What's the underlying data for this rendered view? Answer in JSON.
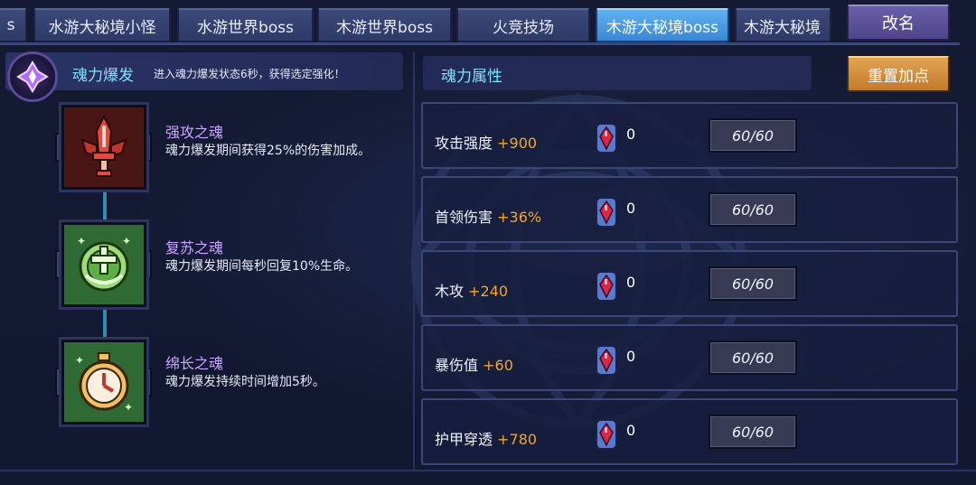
{
  "tabs": [
    {
      "label": "s",
      "active": false
    },
    {
      "label": "水游大秘境小怪",
      "active": false
    },
    {
      "label": "水游世界boss",
      "active": false
    },
    {
      "label": "木游世界boss",
      "active": false
    },
    {
      "label": "火竞技场",
      "active": false
    },
    {
      "label": "木游大秘境boss",
      "active": true
    },
    {
      "label": "木游大秘境",
      "active": false
    }
  ],
  "rename_label": "改名",
  "burst": {
    "title": "魂力爆发",
    "description": "进入魂力爆发状态6秒，获得选定强化！"
  },
  "skills": [
    {
      "name": "强攻之魂",
      "description": "魂力爆发期间获得25%的伤害加成。",
      "icon": "red-sword-icon"
    },
    {
      "name": "复苏之魂",
      "description": "魂力爆发期间每秒回复10%生命。",
      "icon": "green-heal-icon"
    },
    {
      "name": "绵长之魂",
      "description": "魂力爆发持续时间增加5秒。",
      "icon": "clock-icon"
    }
  ],
  "attributes_title": "魂力属性",
  "reset_label": "重置加点",
  "attributes": [
    {
      "name": "攻击强度",
      "bonus": "+900",
      "count": "0",
      "cap": "60/60"
    },
    {
      "name": "首领伤害",
      "bonus": "+36%",
      "count": "0",
      "cap": "60/60"
    },
    {
      "name": "木攻",
      "bonus": "+240",
      "count": "0",
      "cap": "60/60"
    },
    {
      "name": "暴伤值",
      "bonus": "+60",
      "count": "0",
      "cap": "60/60"
    },
    {
      "name": "护甲穿透",
      "bonus": "+780",
      "count": "0",
      "cap": "60/60"
    }
  ],
  "colors": {
    "active_tab": "#4a9de3",
    "bonus": "#f5a623",
    "title_cyan": "#7fe3ff",
    "skill_name": "#c9a6ff"
  }
}
